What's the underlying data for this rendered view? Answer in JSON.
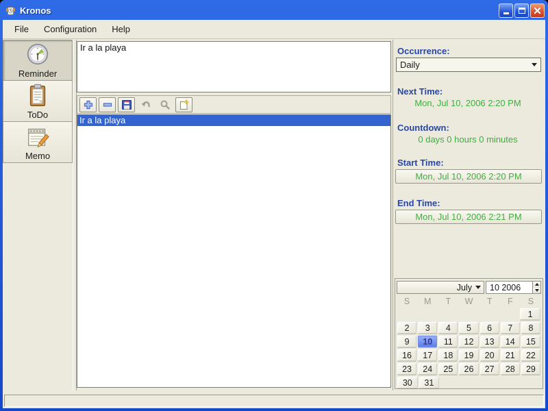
{
  "window": {
    "title": "Kronos",
    "controls": [
      {
        "name": "minimize-button",
        "icon": "minimize-icon"
      },
      {
        "name": "maximize-button",
        "icon": "maximize-icon"
      },
      {
        "name": "close-button",
        "icon": "close-icon"
      }
    ]
  },
  "menu": {
    "items": [
      "File",
      "Configuration",
      "Help"
    ]
  },
  "sidebar": {
    "items": [
      {
        "label": "Reminder",
        "icon": "clock-icon",
        "selected": true
      },
      {
        "label": "ToDo",
        "icon": "clipboard-icon",
        "selected": false
      },
      {
        "label": "Memo",
        "icon": "notepad-icon",
        "selected": false
      }
    ]
  },
  "editor": {
    "text": "Ir a la playa"
  },
  "toolbar": {
    "buttons": [
      {
        "name": "add-button",
        "icon": "plus-icon",
        "enabled": true
      },
      {
        "name": "remove-button",
        "icon": "minus-icon",
        "enabled": true
      },
      {
        "name": "save-button",
        "icon": "save-icon",
        "enabled": true
      },
      {
        "name": "undo-button",
        "icon": "undo-icon",
        "enabled": false
      },
      {
        "name": "search-button",
        "icon": "search-icon",
        "enabled": false
      },
      {
        "name": "new-button",
        "icon": "new-note-icon",
        "enabled": true
      }
    ]
  },
  "list": {
    "items": [
      {
        "text": "Ir a la playa",
        "selected": true
      }
    ]
  },
  "details": {
    "occurrence_label": "Occurrence:",
    "occurrence_value": "Daily",
    "next_time_label": "Next Time:",
    "next_time_value": "Mon, Jul 10, 2006 2:20 PM",
    "countdown_label": "Countdown:",
    "countdown_value": "0 days 0 hours 0 minutes",
    "start_time_label": "Start Time:",
    "start_time_value": "Mon, Jul 10, 2006 2:20 PM",
    "end_time_label": "End Time:",
    "end_time_value": "Mon, Jul 10, 2006 2:21 PM"
  },
  "calendar": {
    "month": "July",
    "year_spinner_value": "10 2006",
    "day_headers": [
      "S",
      "M",
      "T",
      "W",
      "T",
      "F",
      "S"
    ],
    "weeks": [
      [
        "",
        "",
        "",
        "",
        "",
        "",
        "1"
      ],
      [
        "2",
        "3",
        "4",
        "5",
        "6",
        "7",
        "8"
      ],
      [
        "9",
        "10",
        "11",
        "12",
        "13",
        "14",
        "15"
      ],
      [
        "16",
        "17",
        "18",
        "19",
        "20",
        "21",
        "22"
      ],
      [
        "23",
        "24",
        "25",
        "26",
        "27",
        "28",
        "29"
      ],
      [
        "30",
        "31",
        "",
        "",
        "",
        "",
        ""
      ]
    ],
    "selected_day": "10"
  },
  "status": {
    "text": ""
  },
  "colors": {
    "titlebar_top": "#2F6BE6",
    "titlebar_bottom": "#1549CC",
    "label_blue": "#2746A8",
    "value_green": "#3FAE3F",
    "selection_blue": "#3363CF",
    "background_beige": "#ECEADD",
    "calendar_selection_top": "#97AFF5",
    "calendar_selection_bottom": "#5B80EC"
  }
}
